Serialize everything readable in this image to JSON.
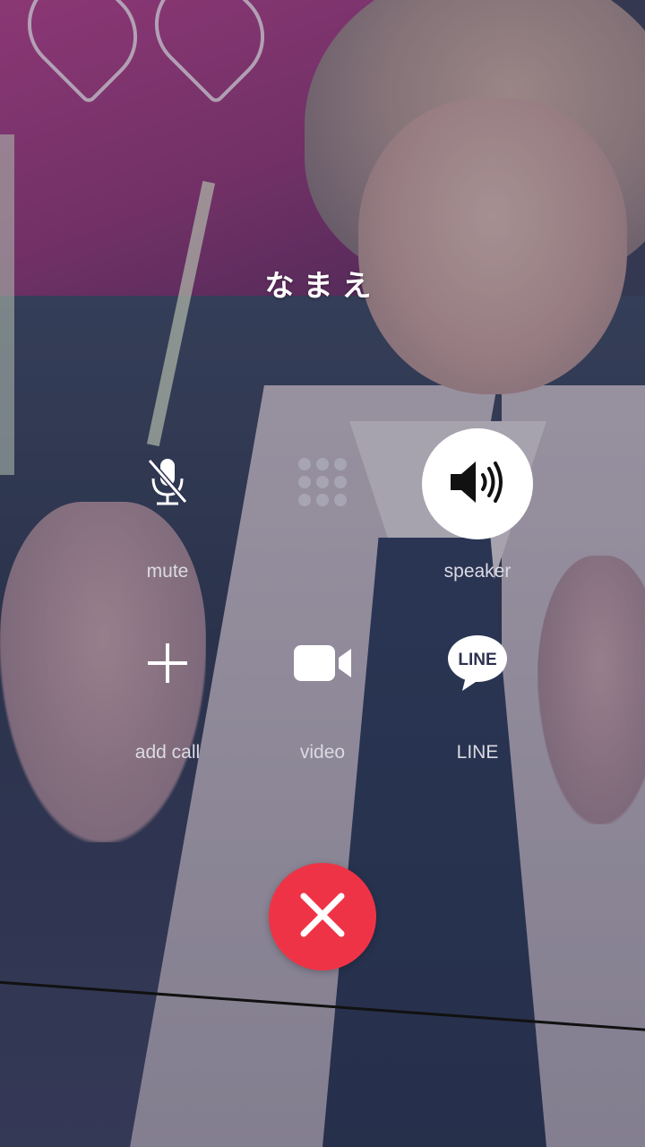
{
  "call": {
    "caller_name": "なまえ"
  },
  "controls": {
    "mute": {
      "label": "mute",
      "icon": "mic-off-icon"
    },
    "keypad": {
      "label": "",
      "icon": "keypad-icon"
    },
    "speaker": {
      "label": "speaker",
      "icon": "speaker-icon",
      "active": true
    },
    "add_call": {
      "label": "add call",
      "icon": "plus-icon"
    },
    "video": {
      "label": "video",
      "icon": "video-camera-icon"
    },
    "line": {
      "label": "LINE",
      "icon": "line-logo-icon",
      "icon_text": "LINE"
    }
  },
  "end_call": {
    "icon": "close-icon",
    "color": "#ef3347"
  },
  "colors": {
    "label_text": "#dcdbe3",
    "end_call_red": "#ef3347",
    "active_circle": "#ffffff"
  }
}
